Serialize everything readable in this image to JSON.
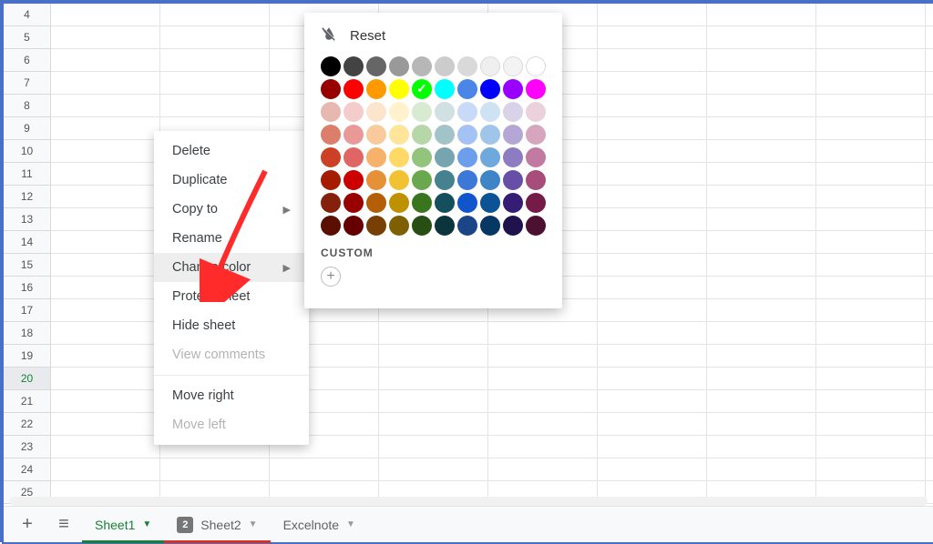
{
  "rows": [
    "4",
    "5",
    "6",
    "7",
    "8",
    "9",
    "10",
    "11",
    "12",
    "13",
    "14",
    "15",
    "16",
    "17",
    "18",
    "19",
    "20",
    "21",
    "22",
    "23",
    "24",
    "25"
  ],
  "selected_row": "20",
  "tabs": {
    "sheet1": "Sheet1",
    "sheet2": "Sheet2",
    "sheet2_badge": "2",
    "excelnote": "Excelnote"
  },
  "menu": {
    "delete": "Delete",
    "duplicate": "Duplicate",
    "copy_to": "Copy to",
    "rename": "Rename",
    "change_color": "Change color",
    "protect_sheet": "Protect sheet",
    "hide_sheet": "Hide sheet",
    "view_comments": "View comments",
    "move_right": "Move right",
    "move_left": "Move left"
  },
  "color_panel": {
    "reset": "Reset",
    "custom_label": "CUSTOM",
    "selected": "#00ff00",
    "palette_row1": [
      "#000000",
      "#434343",
      "#666666",
      "#999999",
      "#b7b7b7",
      "#cccccc",
      "#d9d9d9",
      "#efefef",
      "#f3f3f3",
      "#ffffff"
    ],
    "palette_row2": [
      "#980000",
      "#ff0000",
      "#ff9900",
      "#ffff00",
      "#00ff00",
      "#00ffff",
      "#4a86e8",
      "#0000ff",
      "#9900ff",
      "#ff00ff"
    ],
    "palette_row3": [
      "#e6b8af",
      "#f4cccc",
      "#fce5cd",
      "#fff2cc",
      "#d9ead3",
      "#d0e0e3",
      "#c9daf8",
      "#cfe2f3",
      "#d9d2e9",
      "#ead1dc"
    ],
    "palette_row4": [
      "#dd7e6b",
      "#ea9999",
      "#f9cb9c",
      "#ffe599",
      "#b6d7a8",
      "#a2c4c9",
      "#a4c2f4",
      "#9fc5e8",
      "#b4a7d6",
      "#d5a6bd"
    ],
    "palette_row5": [
      "#cc4125",
      "#e06666",
      "#f6b26b",
      "#ffd966",
      "#93c47d",
      "#76a5af",
      "#6d9eeb",
      "#6fa8dc",
      "#8e7cc3",
      "#c27ba0"
    ],
    "palette_row6": [
      "#a61c00",
      "#cc0000",
      "#e69138",
      "#f1c232",
      "#6aa84f",
      "#45818e",
      "#3c78d8",
      "#3d85c6",
      "#674ea7",
      "#a64d79"
    ],
    "palette_row7": [
      "#85200c",
      "#990000",
      "#b45f06",
      "#bf9000",
      "#38761d",
      "#134f5c",
      "#1155cc",
      "#0b5394",
      "#351c75",
      "#741b47"
    ],
    "palette_row8": [
      "#5b0f00",
      "#660000",
      "#783f04",
      "#7f6000",
      "#274e13",
      "#0c343d",
      "#1c4587",
      "#073763",
      "#20124d",
      "#4c1130"
    ]
  }
}
